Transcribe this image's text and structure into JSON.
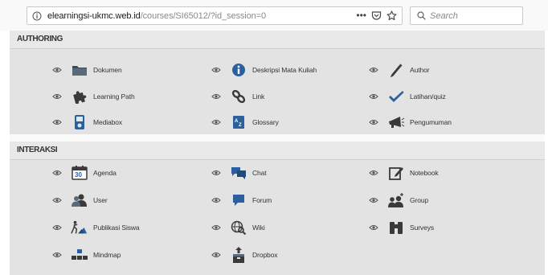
{
  "browser": {
    "url_host": "elearningsi-ukmc.web.id",
    "url_path": "/courses/SI65012/?id_session=0",
    "more_label": "•••",
    "search_placeholder": "Search"
  },
  "sections": {
    "authoring": {
      "title": "AUTHORING",
      "items": [
        {
          "label": "Dokumen",
          "icon": "folder-icon"
        },
        {
          "label": "Deskripsi Mata Kuliah",
          "icon": "info-icon"
        },
        {
          "label": "Author",
          "icon": "pencil-icon"
        },
        {
          "label": "Learning Path",
          "icon": "puzzle-icon"
        },
        {
          "label": "Link",
          "icon": "link-icon"
        },
        {
          "label": "Latihan/quiz",
          "icon": "checkmark-icon"
        },
        {
          "label": "Mediabox",
          "icon": "mediabox-icon"
        },
        {
          "label": "Glossary",
          "icon": "glossary-icon"
        },
        {
          "label": "Pengumuman",
          "icon": "megaphone-icon"
        }
      ]
    },
    "interaksi": {
      "title": "INTERAKSI",
      "items": [
        {
          "label": "Agenda",
          "icon": "calendar-icon",
          "badge": "30"
        },
        {
          "label": "Chat",
          "icon": "chat-icon"
        },
        {
          "label": "Notebook",
          "icon": "notebook-icon"
        },
        {
          "label": "User",
          "icon": "users-icon"
        },
        {
          "label": "Forum",
          "icon": "forum-icon"
        },
        {
          "label": "Group",
          "icon": "group-icon"
        },
        {
          "label": "Publikasi Siswa",
          "icon": "publish-icon"
        },
        {
          "label": "Wiki",
          "icon": "wiki-icon"
        },
        {
          "label": "Surveys",
          "icon": "binoculars-icon"
        },
        {
          "label": "Mindmap",
          "icon": "mindmap-icon"
        },
        {
          "label": "Dropbox",
          "icon": "dropbox-icon"
        }
      ]
    }
  },
  "colors": {
    "icon_dark": "#3a3a3a",
    "icon_blue": "#2b5f9e",
    "panel_bg": "#e3e3e3"
  }
}
